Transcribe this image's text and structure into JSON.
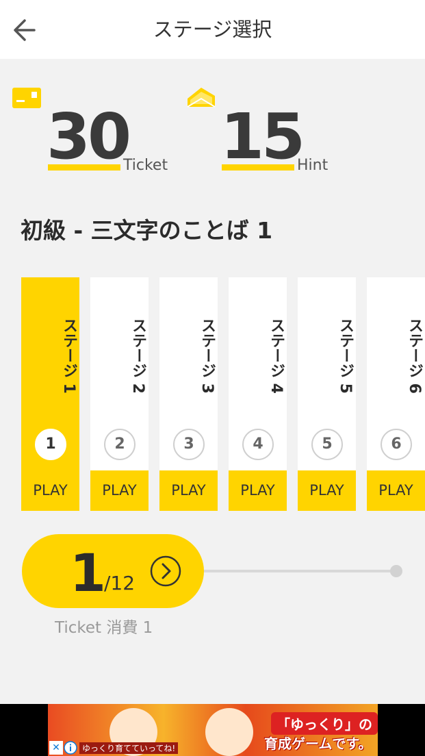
{
  "header": {
    "title": "ステージ選択",
    "back_icon": "back-arrow-icon"
  },
  "stats": {
    "ticket": {
      "value": "30",
      "unit": "Ticket",
      "icon": "ticket-icon"
    },
    "hint": {
      "value": "15",
      "unit": "Hint",
      "icon": "envelope-icon"
    }
  },
  "section_title": "初級 - 三文字のことば 1",
  "stages": [
    {
      "name": "ステージ 1",
      "number": "1",
      "play_label": "PLAY",
      "selected": true
    },
    {
      "name": "ステージ 2",
      "number": "2",
      "play_label": "PLAY",
      "selected": false
    },
    {
      "name": "ステージ 3",
      "number": "3",
      "play_label": "PLAY",
      "selected": false
    },
    {
      "name": "ステージ 4",
      "number": "4",
      "play_label": "PLAY",
      "selected": false
    },
    {
      "name": "ステージ 5",
      "number": "5",
      "play_label": "PLAY",
      "selected": false
    },
    {
      "name": "ステージ 6",
      "number": "6",
      "play_label": "PLAY",
      "selected": false
    }
  ],
  "pager": {
    "current": "1",
    "total": "/12",
    "next_icon": "chevron-right-circle-icon",
    "ticket_cost": "Ticket 消費 1"
  },
  "ad": {
    "headline": "「ゆっくり」の",
    "subline": "育成ゲームです。",
    "caption": "ゆっくり育てていってね!",
    "close_icon": "close-icon",
    "info_icon": "info-icon"
  },
  "colors": {
    "accent": "#ffd400",
    "background": "#f2f2f2",
    "text": "#333333"
  }
}
